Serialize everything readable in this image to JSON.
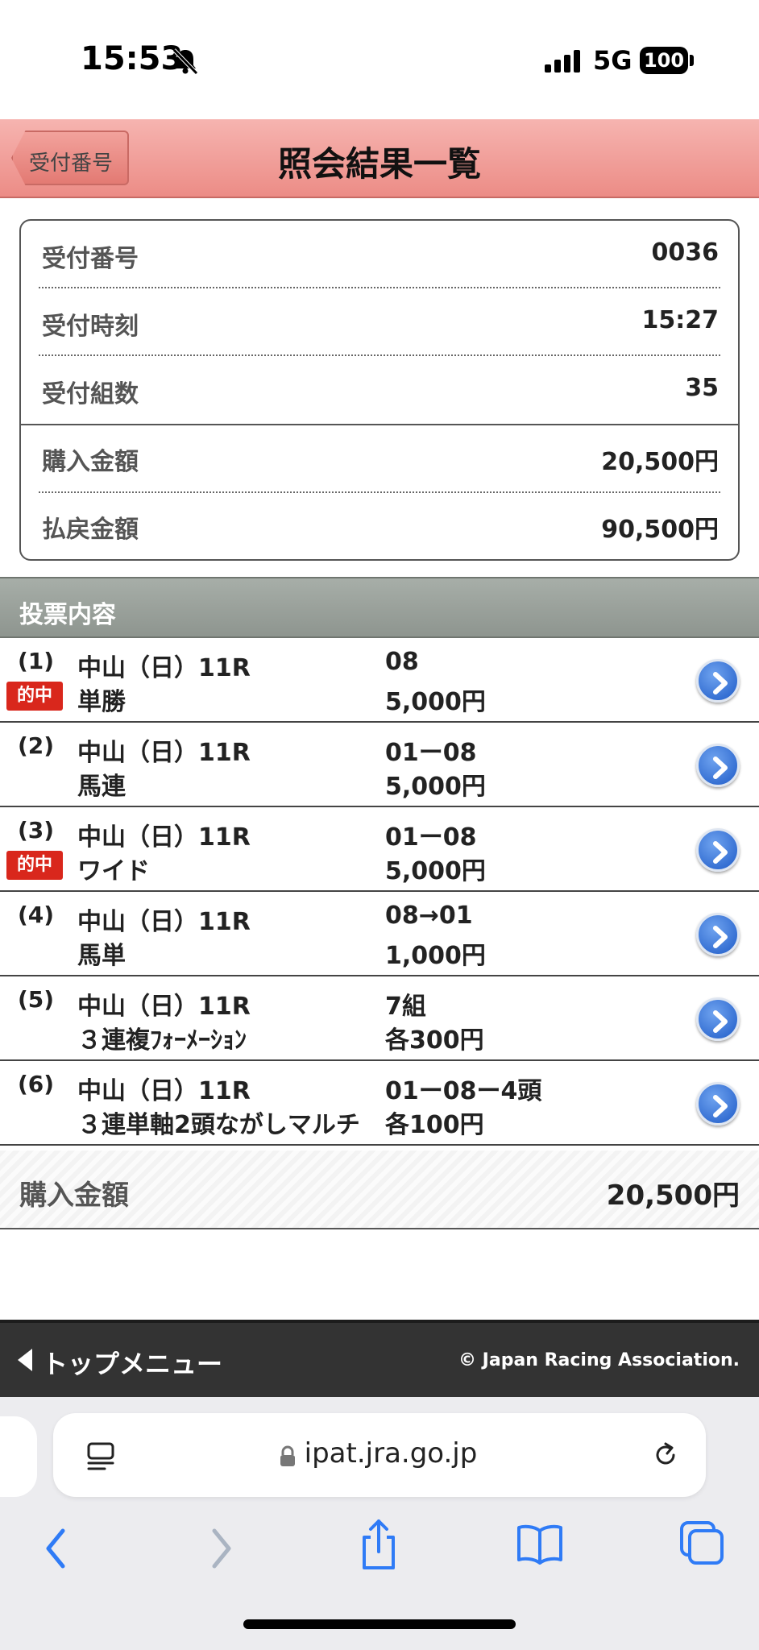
{
  "status_bar": {
    "time": "15:53",
    "network": "5G",
    "battery": "100"
  },
  "header": {
    "back_label": "受付番号",
    "title": "照会結果一覧"
  },
  "summary": {
    "rows": [
      {
        "label": "受付番号",
        "value": "0036"
      },
      {
        "label": "受付時刻",
        "value": "15:27"
      },
      {
        "label": "受付組数",
        "value": "35"
      },
      {
        "label": "購入金額",
        "value": "20,500円"
      },
      {
        "label": "払戻金額",
        "value": "90,500円"
      }
    ]
  },
  "section_title": "投票内容",
  "hit_badge": "的中",
  "bets": [
    {
      "index": "(1)",
      "race": "中山（日）11R",
      "type": "単勝",
      "combination": "08",
      "amount": "5,000円",
      "hit": true
    },
    {
      "index": "(2)",
      "race": "中山（日）11R",
      "type": "馬連",
      "combination": "01ー08",
      "amount": "5,000円",
      "hit": false
    },
    {
      "index": "(3)",
      "race": "中山（日）11R",
      "type": "ワイド",
      "combination": "01ー08",
      "amount": "5,000円",
      "hit": true
    },
    {
      "index": "(4)",
      "race": "中山（日）11R",
      "type": "馬単",
      "combination": "08→01",
      "amount": "1,000円",
      "hit": false
    },
    {
      "index": "(5)",
      "race": "中山（日）11R",
      "type": "３連複ﾌｫｰﾒｰｼｮﾝ",
      "combination": "7組",
      "amount": "各300円",
      "hit": false
    },
    {
      "index": "(6)",
      "race": "中山（日）11R",
      "type": "３連単軸2頭ながしマルチ",
      "combination": "01ー08ー4頭",
      "amount": "各100円",
      "hit": false
    }
  ],
  "total": {
    "label": "購入金額",
    "value": "20,500円"
  },
  "footer": {
    "menu_label": "トップメニュー",
    "copyright": "© Japan Racing Association."
  },
  "browser": {
    "url": "ipat.jra.go.jp"
  }
}
